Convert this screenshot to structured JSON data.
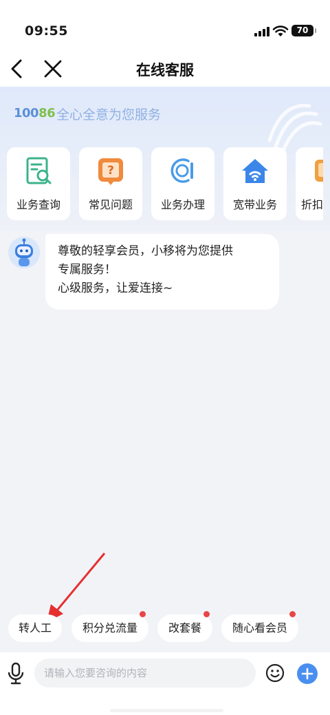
{
  "status_bar": {
    "time": "09:55",
    "battery": "70"
  },
  "nav": {
    "title": "在线客服",
    "back_icon": "chevron-left-icon",
    "close_icon": "close-icon"
  },
  "hero": {
    "logo_prefix": "100",
    "logo_highlight": "86",
    "slogan": "全心全意为您服务"
  },
  "services": [
    {
      "label": "业务查询",
      "icon": "document-search-icon",
      "color": "#3bb38a"
    },
    {
      "label": "常见问题",
      "icon": "faq-icon",
      "color": "#f08a3c"
    },
    {
      "label": "业务办理",
      "icon": "service-dial-icon",
      "color": "#4a9be8"
    },
    {
      "label": "宽带业务",
      "icon": "home-wifi-icon",
      "color": "#3b86e8"
    },
    {
      "label": "折扣",
      "icon": "discount-icon",
      "color": "#f0a040"
    }
  ],
  "chat": {
    "bot_avatar": "robot-avatar",
    "message_lines": [
      "尊敬的轻享会员，小移将为您提供",
      "专属服务！",
      "心级服务，让爱连接~"
    ]
  },
  "quick_replies": [
    {
      "label": "转人工",
      "dot": false
    },
    {
      "label": "积分兑流量",
      "dot": true
    },
    {
      "label": "改套餐",
      "dot": true
    },
    {
      "label": "随心看会员",
      "dot": true
    }
  ],
  "input": {
    "placeholder": "请输入您要咨询的内容",
    "value": ""
  },
  "colors": {
    "accent": "#4a8ff0",
    "badge": "#e84545",
    "annotation_arrow": "#e53030"
  }
}
